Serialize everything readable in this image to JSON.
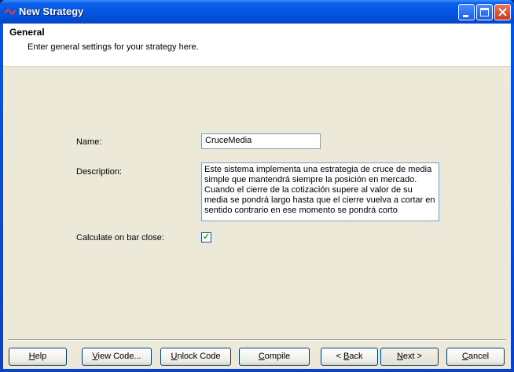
{
  "window": {
    "title": "New Strategy",
    "icon": "strategy-wave-icon"
  },
  "header": {
    "title": "General",
    "subtitle": "Enter general settings for your strategy here."
  },
  "form": {
    "name_label": "Name:",
    "name_value": "CruceMedia",
    "description_label": "Description:",
    "description_value": "Este sistema implementa una estrategia de cruce de media simple que mantendrá siempre la posición en mercado. Cuando el cierre de la cotización supere al valor de su media se pondrá largo hasta que el cierre vuelva a cortar en sentido contrario en ese momento se pondrá corto",
    "calc_label": "Calculate on bar close:",
    "calc_checked": true
  },
  "buttons": {
    "help": {
      "pre": "",
      "key": "H",
      "post": "elp"
    },
    "view_code": {
      "pre": "",
      "key": "V",
      "post": "iew Code..."
    },
    "unlock_code": {
      "pre": "",
      "key": "U",
      "post": "nlock Code"
    },
    "compile": {
      "pre": "",
      "key": "C",
      "post": "ompile"
    },
    "back": {
      "pre": "< ",
      "key": "B",
      "post": "ack"
    },
    "next": {
      "pre": "",
      "key": "N",
      "post": "ext >"
    },
    "cancel": {
      "pre": "",
      "key": "C",
      "post": "ancel"
    }
  }
}
